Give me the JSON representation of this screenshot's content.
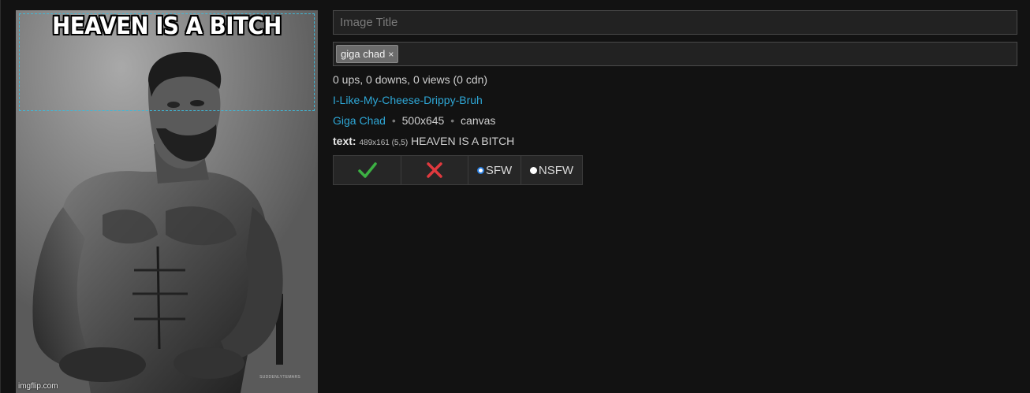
{
  "meme": {
    "caption": "HEAVEN IS A BITCH",
    "watermark": "imgflip.com",
    "signature": "SUDDENLYTEMARS"
  },
  "editor": {
    "title_placeholder": "Image Title",
    "title_value": "",
    "tags": [
      {
        "label": "giga chad",
        "remove_symbol": "×"
      }
    ],
    "stats": "0 ups, 0 downs, 0 views (0 cdn)",
    "username": "I-Like-My-Cheese-Drippy-Bruh",
    "template_name": "Giga Chad",
    "separator": "•",
    "dimensions": "500x645",
    "kind": "canvas",
    "text_label": "text:",
    "text_box_info": "489x161 (5,5)",
    "text_value": "HEAVEN IS A BITCH"
  },
  "moderation": {
    "approve_icon": "check-icon",
    "reject_icon": "x-icon",
    "approve_color": "#3cb043",
    "reject_color": "#e0393e",
    "sfw_label": "SFW",
    "nsfw_label": "NSFW",
    "selected": "SFW"
  }
}
